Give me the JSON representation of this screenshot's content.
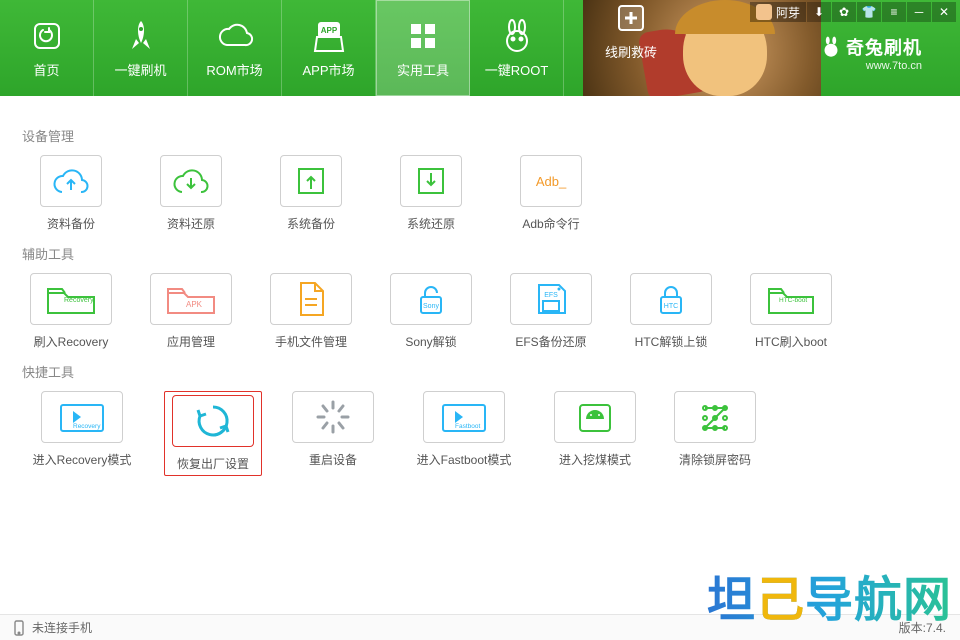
{
  "titlebar": {
    "user_name": "阿芽",
    "icons": [
      "download-icon",
      "skin-icon",
      "shirt-icon",
      "menu-icon",
      "minimize-icon",
      "close-icon"
    ]
  },
  "brand": {
    "name": "奇兔刷机",
    "url": "www.7to.cn"
  },
  "nav": [
    {
      "id": "home",
      "label": "首页"
    },
    {
      "id": "one-key-flash",
      "label": "一键刷机"
    },
    {
      "id": "rom-market",
      "label": "ROM市场"
    },
    {
      "id": "app-market",
      "label": "APP市场"
    },
    {
      "id": "tools",
      "label": "实用工具",
      "active": true
    },
    {
      "id": "one-key-root",
      "label": "一键ROOT"
    },
    {
      "id": "line-flash",
      "label": "线刷救砖"
    }
  ],
  "sections": {
    "device": {
      "title": "设备管理",
      "items": [
        {
          "id": "backup",
          "label": "资料备份"
        },
        {
          "id": "restore",
          "label": "资料还原"
        },
        {
          "id": "sys-backup",
          "label": "系统备份"
        },
        {
          "id": "sys-restore",
          "label": "系统还原"
        },
        {
          "id": "adb",
          "label": "Adb命令行",
          "badge": "Adb_"
        }
      ]
    },
    "assist": {
      "title": "辅助工具",
      "items": [
        {
          "id": "flash-recovery",
          "label": "刷入Recovery",
          "badge": "Recovery"
        },
        {
          "id": "app-manage",
          "label": "应用管理",
          "badge": "APK"
        },
        {
          "id": "file-manage",
          "label": "手机文件管理"
        },
        {
          "id": "sony-unlock",
          "label": "Sony解锁",
          "badge": "Sony"
        },
        {
          "id": "efs-backup",
          "label": "EFS备份还原",
          "badge": "EFS"
        },
        {
          "id": "htc-unlock",
          "label": "HTC解锁上锁",
          "badge": "HTC"
        },
        {
          "id": "htc-boot",
          "label": "HTC刷入boot",
          "badge": "HTC-boot"
        }
      ]
    },
    "quick": {
      "title": "快捷工具",
      "items": [
        {
          "id": "enter-recovery",
          "label": "进入Recovery模式",
          "badge": "Recovery"
        },
        {
          "id": "factory-reset",
          "label": "恢复出厂设置",
          "selected": true
        },
        {
          "id": "reboot",
          "label": "重启设备"
        },
        {
          "id": "enter-fastboot",
          "label": "进入Fastboot模式",
          "badge": "Fastboot"
        },
        {
          "id": "enter-miner",
          "label": "进入挖煤模式"
        },
        {
          "id": "clear-lock",
          "label": "清除锁屏密码"
        }
      ]
    }
  },
  "status": {
    "left": "未连接手机",
    "right": "版本:7.4."
  },
  "watermark": {
    "a": "坦",
    "b": "己",
    "c": "导航网"
  }
}
